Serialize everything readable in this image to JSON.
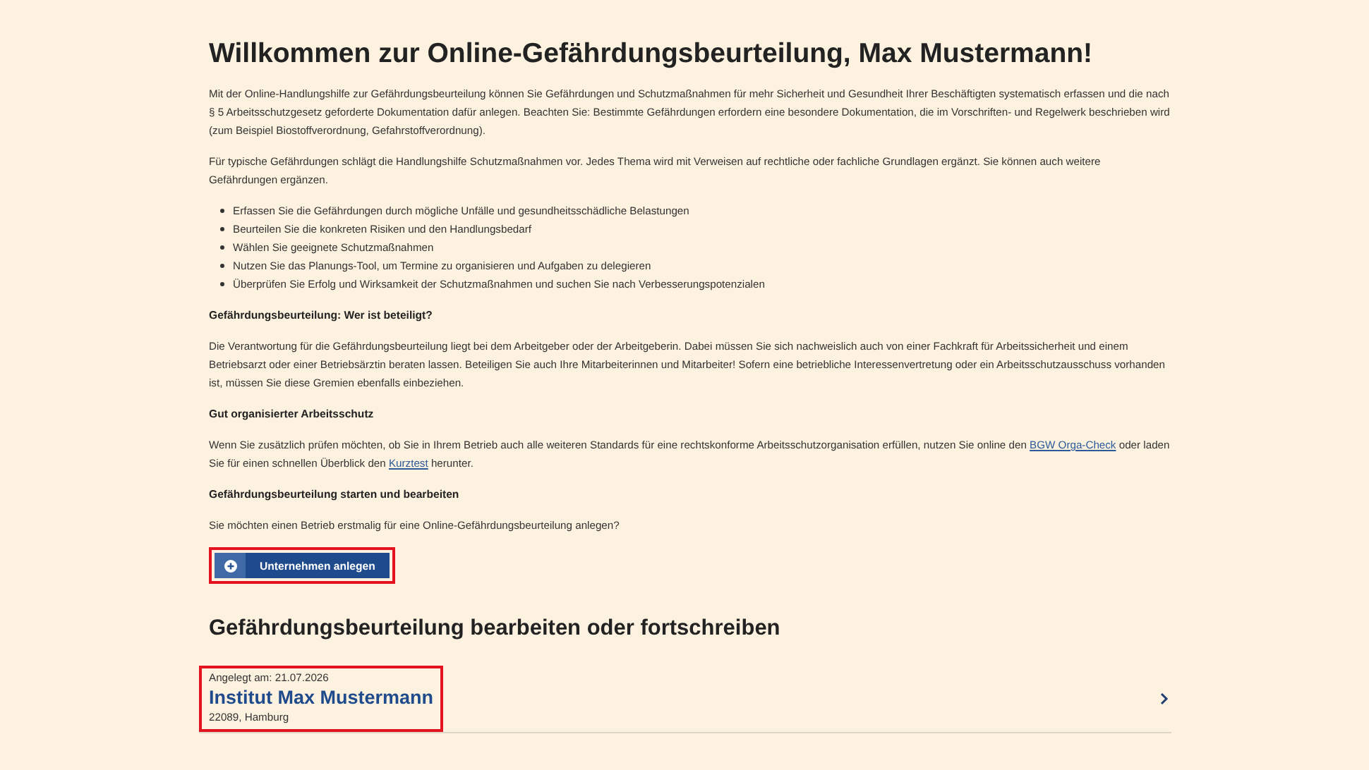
{
  "title": "Willkommen zur Online-Gefährdungsbeurteilung, Max Mustermann!",
  "intro": [
    {
      "kind": "paragraph",
      "parts": [
        {
          "kind": "text",
          "text": "Mit der Online-Handlungshilfe zur Gefährdungsbeurteilung können Sie Gefährdungen und Schutzmaßnahmen für mehr Sicherheit und Gesundheit Ihrer Beschäftigten systematisch erfassen und die nach § 5 Arbeitsschutzgesetz geforderte Dokumentation dafür anlegen. Beachten Sie: Bestimmte Gefährdungen erfordern eine besondere Dokumentation, die im Vorschriften- und Regelwerk beschrieben wird (zum Beispiel Biostoffverordnung, Gefahrstoffverordnung)."
        }
      ]
    },
    {
      "kind": "paragraph",
      "parts": [
        {
          "kind": "text",
          "text": "Für typische Gefährdungen schlägt die Handlungshilfe Schutzmaßnahmen vor. Jedes Thema wird mit Verweisen auf rechtliche oder fachliche Grundlagen ergänzt. Sie können auch weitere Gefährdungen ergänzen."
        }
      ]
    },
    {
      "kind": "list",
      "items": [
        "Erfassen Sie die Gefährdungen durch mögliche Unfälle und gesundheitsschädliche Belastungen",
        "Beurteilen Sie die konkreten Risiken und den Handlungsbedarf",
        "Wählen Sie geeignete Schutzmaßnahmen",
        "Nutzen Sie das Planungs-Tool, um Termine zu organisieren und Aufgaben zu delegieren",
        "Überprüfen Sie Erfolg und Wirksamkeit der Schutzmaßnahmen und suchen Sie nach Verbesserungspotenzialen"
      ]
    },
    {
      "kind": "heading",
      "text": "Gefährdungsbeurteilung: Wer ist beteiligt?"
    },
    {
      "kind": "paragraph",
      "parts": [
        {
          "kind": "text",
          "text": "Die Verantwortung für die Gefährdungsbeurteilung liegt bei dem Arbeitgeber oder der Arbeitgeberin. Dabei müssen Sie sich nachweislich auch von einer Fachkraft für Arbeitssicherheit und einem Betriebsarzt oder einer Betriebsärztin beraten lassen. Beteiligen Sie auch Ihre Mitarbeiterinnen und Mitarbeiter! Sofern eine betriebliche Interessenvertretung oder ein Arbeitsschutzausschuss vorhanden ist, müssen Sie diese Gremien ebenfalls einbeziehen."
        }
      ]
    },
    {
      "kind": "heading",
      "text": "Gut organisierter Arbeitsschutz"
    },
    {
      "kind": "paragraph",
      "parts": [
        {
          "kind": "text",
          "text": "Wenn Sie zusätzlich prüfen möchten, ob Sie in Ihrem Betrieb auch alle weiteren Standards für eine rechtskonforme Arbeitsschutzorganisation erfüllen, nutzen Sie online den "
        },
        {
          "kind": "link",
          "text": "BGW Orga-Check"
        },
        {
          "kind": "text",
          "text": " oder laden Sie für einen schnellen Überblick den "
        },
        {
          "kind": "link",
          "text": "Kurztest"
        },
        {
          "kind": "text",
          "text": " herunter."
        }
      ]
    },
    {
      "kind": "heading",
      "text": "Gefährdungsbeurteilung starten und bearbeiten"
    },
    {
      "kind": "paragraph",
      "parts": [
        {
          "kind": "text",
          "text": "Sie möchten einen Betrieb erstmalig für eine Online-Gefährdungsbeurteilung anlegen?"
        }
      ]
    }
  ],
  "create_button": {
    "label": "Unternehmen anlegen",
    "highlighted": true
  },
  "section_title": "Gefährdungsbeurteilung bearbeiten oder fortschreiben",
  "companies": [
    {
      "created": "Angelegt am: 21.07.2026",
      "name": "Institut Max Mustermann",
      "address": "22089, Hamburg",
      "highlighted": true
    }
  ]
}
